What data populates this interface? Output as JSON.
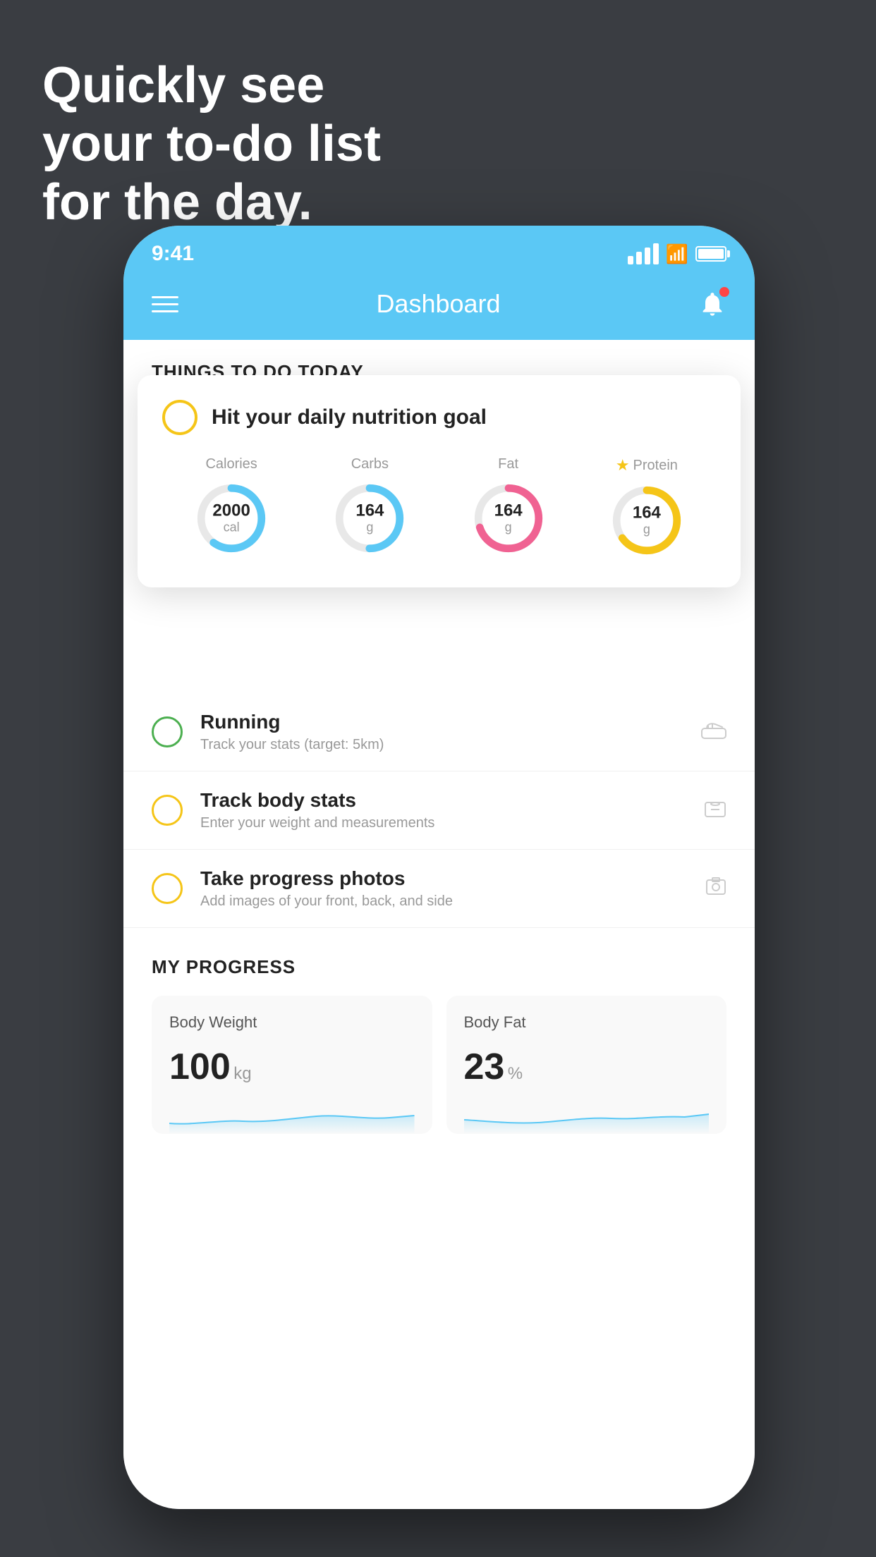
{
  "headline": {
    "line1": "Quickly see",
    "line2": "your to-do list",
    "line3": "for the day."
  },
  "status_bar": {
    "time": "9:41"
  },
  "nav": {
    "title": "Dashboard"
  },
  "things_section": {
    "title": "THINGS TO DO TODAY"
  },
  "nutrition_card": {
    "title": "Hit your daily nutrition goal",
    "nutrients": [
      {
        "label": "Calories",
        "value": "2000",
        "unit": "cal",
        "color": "#5bc8f5",
        "progress": 0.6
      },
      {
        "label": "Carbs",
        "value": "164",
        "unit": "g",
        "color": "#5bc8f5",
        "progress": 0.5
      },
      {
        "label": "Fat",
        "value": "164",
        "unit": "g",
        "color": "#f06292",
        "progress": 0.7
      },
      {
        "label": "Protein",
        "value": "164",
        "unit": "g",
        "color": "#f5c518",
        "progress": 0.65,
        "starred": true
      }
    ]
  },
  "todo_items": [
    {
      "title": "Running",
      "subtitle": "Track your stats (target: 5km)",
      "circle_color": "green",
      "icon": "shoe"
    },
    {
      "title": "Track body stats",
      "subtitle": "Enter your weight and measurements",
      "circle_color": "yellow",
      "icon": "scale"
    },
    {
      "title": "Take progress photos",
      "subtitle": "Add images of your front, back, and side",
      "circle_color": "yellow",
      "icon": "photo"
    }
  ],
  "progress_section": {
    "title": "MY PROGRESS",
    "cards": [
      {
        "title": "Body Weight",
        "value": "100",
        "unit": "kg"
      },
      {
        "title": "Body Fat",
        "value": "23",
        "unit": "%"
      }
    ]
  }
}
